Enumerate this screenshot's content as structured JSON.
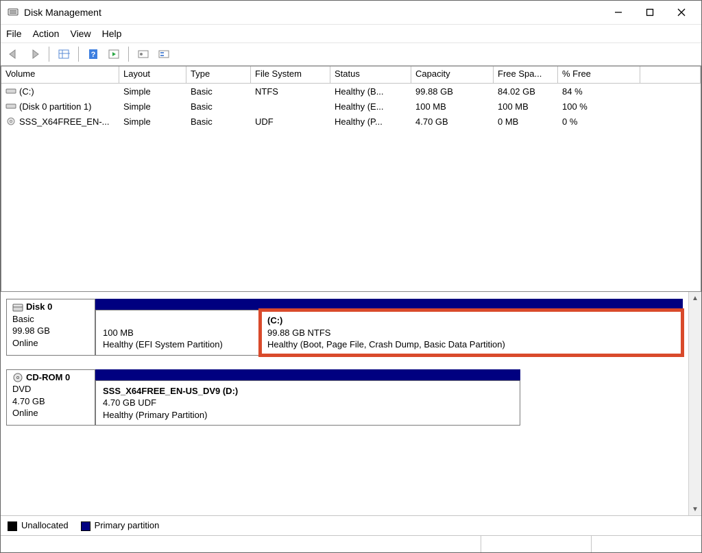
{
  "window": {
    "title": "Disk Management"
  },
  "menu": {
    "file": "File",
    "action": "Action",
    "view": "View",
    "help": "Help"
  },
  "columns": {
    "volume": "Volume",
    "layout": "Layout",
    "type": "Type",
    "fs": "File System",
    "status": "Status",
    "capacity": "Capacity",
    "free": "Free Spa...",
    "pctfree": "% Free"
  },
  "rows": [
    {
      "icon": "drive",
      "name": "(C:)",
      "layout": "Simple",
      "type": "Basic",
      "fs": "NTFS",
      "status": "Healthy (B...",
      "capacity": "99.88 GB",
      "free": "84.02 GB",
      "pctfree": "84 %"
    },
    {
      "icon": "drive",
      "name": "(Disk 0 partition 1)",
      "layout": "Simple",
      "type": "Basic",
      "fs": "",
      "status": "Healthy (E...",
      "capacity": "100 MB",
      "free": "100 MB",
      "pctfree": "100 %"
    },
    {
      "icon": "disc",
      "name": "SSS_X64FREE_EN-...",
      "layout": "Simple",
      "type": "Basic",
      "fs": "UDF",
      "status": "Healthy (P...",
      "capacity": "4.70 GB",
      "free": "0 MB",
      "pctfree": "0 %"
    }
  ],
  "disk0": {
    "label": "Disk 0",
    "type": "Basic",
    "size": "99.98 GB",
    "state": "Online",
    "p1": {
      "size": "100 MB",
      "status": "Healthy (EFI System Partition)"
    },
    "p2": {
      "name": "(C:)",
      "summary": "99.88 GB NTFS",
      "status": "Healthy (Boot, Page File, Crash Dump, Basic Data Partition)"
    }
  },
  "cd0": {
    "label": "CD-ROM 0",
    "type": "DVD",
    "size": "4.70 GB",
    "state": "Online",
    "p1": {
      "name": "SSS_X64FREE_EN-US_DV9  (D:)",
      "summary": "4.70 GB UDF",
      "status": "Healthy (Primary Partition)"
    }
  },
  "legend": {
    "unallocated": "Unallocated",
    "primary": "Primary partition"
  }
}
